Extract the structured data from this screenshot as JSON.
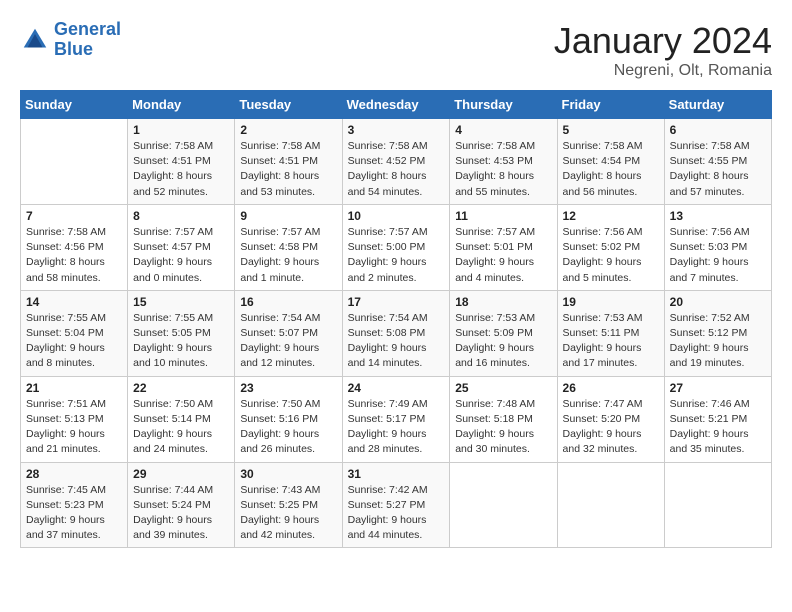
{
  "logo": {
    "line1": "General",
    "line2": "Blue"
  },
  "title": "January 2024",
  "location": "Negreni, Olt, Romania",
  "weekdays": [
    "Sunday",
    "Monday",
    "Tuesday",
    "Wednesday",
    "Thursday",
    "Friday",
    "Saturday"
  ],
  "weeks": [
    [
      {
        "day": "",
        "info": ""
      },
      {
        "day": "1",
        "info": "Sunrise: 7:58 AM\nSunset: 4:51 PM\nDaylight: 8 hours\nand 52 minutes."
      },
      {
        "day": "2",
        "info": "Sunrise: 7:58 AM\nSunset: 4:51 PM\nDaylight: 8 hours\nand 53 minutes."
      },
      {
        "day": "3",
        "info": "Sunrise: 7:58 AM\nSunset: 4:52 PM\nDaylight: 8 hours\nand 54 minutes."
      },
      {
        "day": "4",
        "info": "Sunrise: 7:58 AM\nSunset: 4:53 PM\nDaylight: 8 hours\nand 55 minutes."
      },
      {
        "day": "5",
        "info": "Sunrise: 7:58 AM\nSunset: 4:54 PM\nDaylight: 8 hours\nand 56 minutes."
      },
      {
        "day": "6",
        "info": "Sunrise: 7:58 AM\nSunset: 4:55 PM\nDaylight: 8 hours\nand 57 minutes."
      }
    ],
    [
      {
        "day": "7",
        "info": "Sunrise: 7:58 AM\nSunset: 4:56 PM\nDaylight: 8 hours\nand 58 minutes."
      },
      {
        "day": "8",
        "info": "Sunrise: 7:57 AM\nSunset: 4:57 PM\nDaylight: 9 hours\nand 0 minutes."
      },
      {
        "day": "9",
        "info": "Sunrise: 7:57 AM\nSunset: 4:58 PM\nDaylight: 9 hours\nand 1 minute."
      },
      {
        "day": "10",
        "info": "Sunrise: 7:57 AM\nSunset: 5:00 PM\nDaylight: 9 hours\nand 2 minutes."
      },
      {
        "day": "11",
        "info": "Sunrise: 7:57 AM\nSunset: 5:01 PM\nDaylight: 9 hours\nand 4 minutes."
      },
      {
        "day": "12",
        "info": "Sunrise: 7:56 AM\nSunset: 5:02 PM\nDaylight: 9 hours\nand 5 minutes."
      },
      {
        "day": "13",
        "info": "Sunrise: 7:56 AM\nSunset: 5:03 PM\nDaylight: 9 hours\nand 7 minutes."
      }
    ],
    [
      {
        "day": "14",
        "info": "Sunrise: 7:55 AM\nSunset: 5:04 PM\nDaylight: 9 hours\nand 8 minutes."
      },
      {
        "day": "15",
        "info": "Sunrise: 7:55 AM\nSunset: 5:05 PM\nDaylight: 9 hours\nand 10 minutes."
      },
      {
        "day": "16",
        "info": "Sunrise: 7:54 AM\nSunset: 5:07 PM\nDaylight: 9 hours\nand 12 minutes."
      },
      {
        "day": "17",
        "info": "Sunrise: 7:54 AM\nSunset: 5:08 PM\nDaylight: 9 hours\nand 14 minutes."
      },
      {
        "day": "18",
        "info": "Sunrise: 7:53 AM\nSunset: 5:09 PM\nDaylight: 9 hours\nand 16 minutes."
      },
      {
        "day": "19",
        "info": "Sunrise: 7:53 AM\nSunset: 5:11 PM\nDaylight: 9 hours\nand 17 minutes."
      },
      {
        "day": "20",
        "info": "Sunrise: 7:52 AM\nSunset: 5:12 PM\nDaylight: 9 hours\nand 19 minutes."
      }
    ],
    [
      {
        "day": "21",
        "info": "Sunrise: 7:51 AM\nSunset: 5:13 PM\nDaylight: 9 hours\nand 21 minutes."
      },
      {
        "day": "22",
        "info": "Sunrise: 7:50 AM\nSunset: 5:14 PM\nDaylight: 9 hours\nand 24 minutes."
      },
      {
        "day": "23",
        "info": "Sunrise: 7:50 AM\nSunset: 5:16 PM\nDaylight: 9 hours\nand 26 minutes."
      },
      {
        "day": "24",
        "info": "Sunrise: 7:49 AM\nSunset: 5:17 PM\nDaylight: 9 hours\nand 28 minutes."
      },
      {
        "day": "25",
        "info": "Sunrise: 7:48 AM\nSunset: 5:18 PM\nDaylight: 9 hours\nand 30 minutes."
      },
      {
        "day": "26",
        "info": "Sunrise: 7:47 AM\nSunset: 5:20 PM\nDaylight: 9 hours\nand 32 minutes."
      },
      {
        "day": "27",
        "info": "Sunrise: 7:46 AM\nSunset: 5:21 PM\nDaylight: 9 hours\nand 35 minutes."
      }
    ],
    [
      {
        "day": "28",
        "info": "Sunrise: 7:45 AM\nSunset: 5:23 PM\nDaylight: 9 hours\nand 37 minutes."
      },
      {
        "day": "29",
        "info": "Sunrise: 7:44 AM\nSunset: 5:24 PM\nDaylight: 9 hours\nand 39 minutes."
      },
      {
        "day": "30",
        "info": "Sunrise: 7:43 AM\nSunset: 5:25 PM\nDaylight: 9 hours\nand 42 minutes."
      },
      {
        "day": "31",
        "info": "Sunrise: 7:42 AM\nSunset: 5:27 PM\nDaylight: 9 hours\nand 44 minutes."
      },
      {
        "day": "",
        "info": ""
      },
      {
        "day": "",
        "info": ""
      },
      {
        "day": "",
        "info": ""
      }
    ]
  ]
}
